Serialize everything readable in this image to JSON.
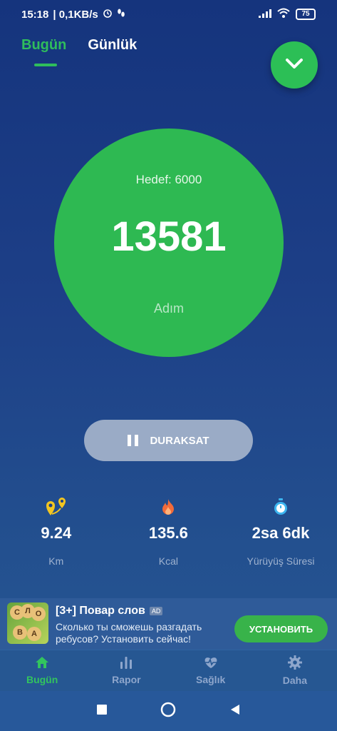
{
  "status_bar": {
    "time": "15:18",
    "network": "| 0,1KB/s",
    "battery": "75"
  },
  "tabs": [
    {
      "label": "Bugün",
      "active": true
    },
    {
      "label": "Günlük",
      "active": false
    }
  ],
  "progress": {
    "goal_text": "Hedef: 6000",
    "steps": "13581",
    "unit": "Adım"
  },
  "pause_button": {
    "label": "DURAKSAT"
  },
  "stats": [
    {
      "icon": "map-pins-icon",
      "value": "9.24",
      "label": "Km"
    },
    {
      "icon": "flame-icon",
      "value": "135.6",
      "label": "Kcal"
    },
    {
      "icon": "stopwatch-icon",
      "value": "2sa 6dk",
      "label": "Yürüyüş Süresi"
    }
  ],
  "ad": {
    "title": "[3+] Повар слов",
    "badge": "AD",
    "body": "Сколько ты сможешь разгадать ребусов? Установить сейчас!",
    "cta": "УСТАНОВИТЬ",
    "image_letters": [
      "С",
      "Л",
      "О",
      "В",
      "А"
    ]
  },
  "bottom_nav": [
    {
      "label": "Bugün",
      "icon": "home-icon",
      "active": true
    },
    {
      "label": "Rapor",
      "icon": "bar-chart-icon",
      "active": false
    },
    {
      "label": "Sağlık",
      "icon": "heart-pulse-icon",
      "active": false
    },
    {
      "label": "Daha",
      "icon": "gear-icon",
      "active": false
    }
  ],
  "colors": {
    "accent": "#2fbd5c",
    "background": "#1d3f87",
    "progress_circle": "#2eb952"
  }
}
